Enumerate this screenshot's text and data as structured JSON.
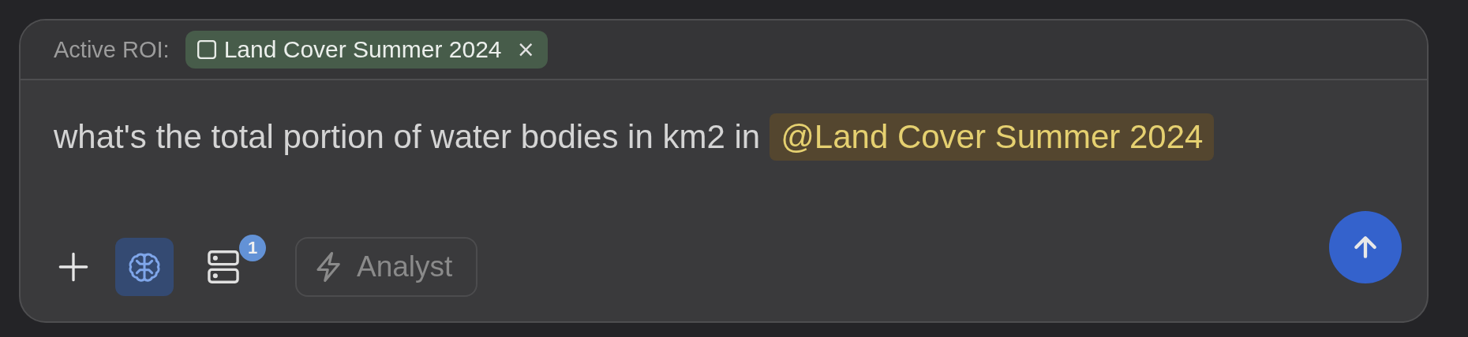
{
  "header": {
    "label": "Active ROI:",
    "roi_chip": {
      "label": "Land Cover Summer 2024",
      "close": "×"
    }
  },
  "message": {
    "text": "what's the total portion of water bodies in km2 in",
    "mention": "@Land Cover Summer 2024"
  },
  "toolbar": {
    "thinking": {
      "selected": true
    },
    "sources": {
      "badge": "1"
    },
    "mode": {
      "label": "Analyst"
    }
  }
}
